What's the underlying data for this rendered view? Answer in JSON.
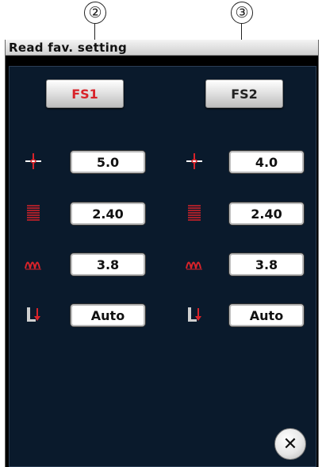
{
  "callouts": [
    "②",
    "③"
  ],
  "window": {
    "title": "Read fav. setting"
  },
  "presets": [
    {
      "label": "FS1",
      "active": true,
      "settings": [
        {
          "icon": "needle-position-icon",
          "value": "5.0"
        },
        {
          "icon": "stitch-length-icon",
          "value": "2.40"
        },
        {
          "icon": "thread-tension-icon",
          "value": "3.8"
        },
        {
          "icon": "presser-foot-pressure-icon",
          "value": "Auto"
        }
      ]
    },
    {
      "label": "FS2",
      "active": false,
      "settings": [
        {
          "icon": "needle-position-icon",
          "value": "4.0"
        },
        {
          "icon": "stitch-length-icon",
          "value": "2.40"
        },
        {
          "icon": "thread-tension-icon",
          "value": "3.8"
        },
        {
          "icon": "presser-foot-pressure-icon",
          "value": "Auto"
        }
      ]
    }
  ],
  "close_icon": "close-icon",
  "colors": {
    "accent": "#d8232a",
    "screen_bg": "#000000",
    "panel_bg": "#0a1a2c"
  }
}
